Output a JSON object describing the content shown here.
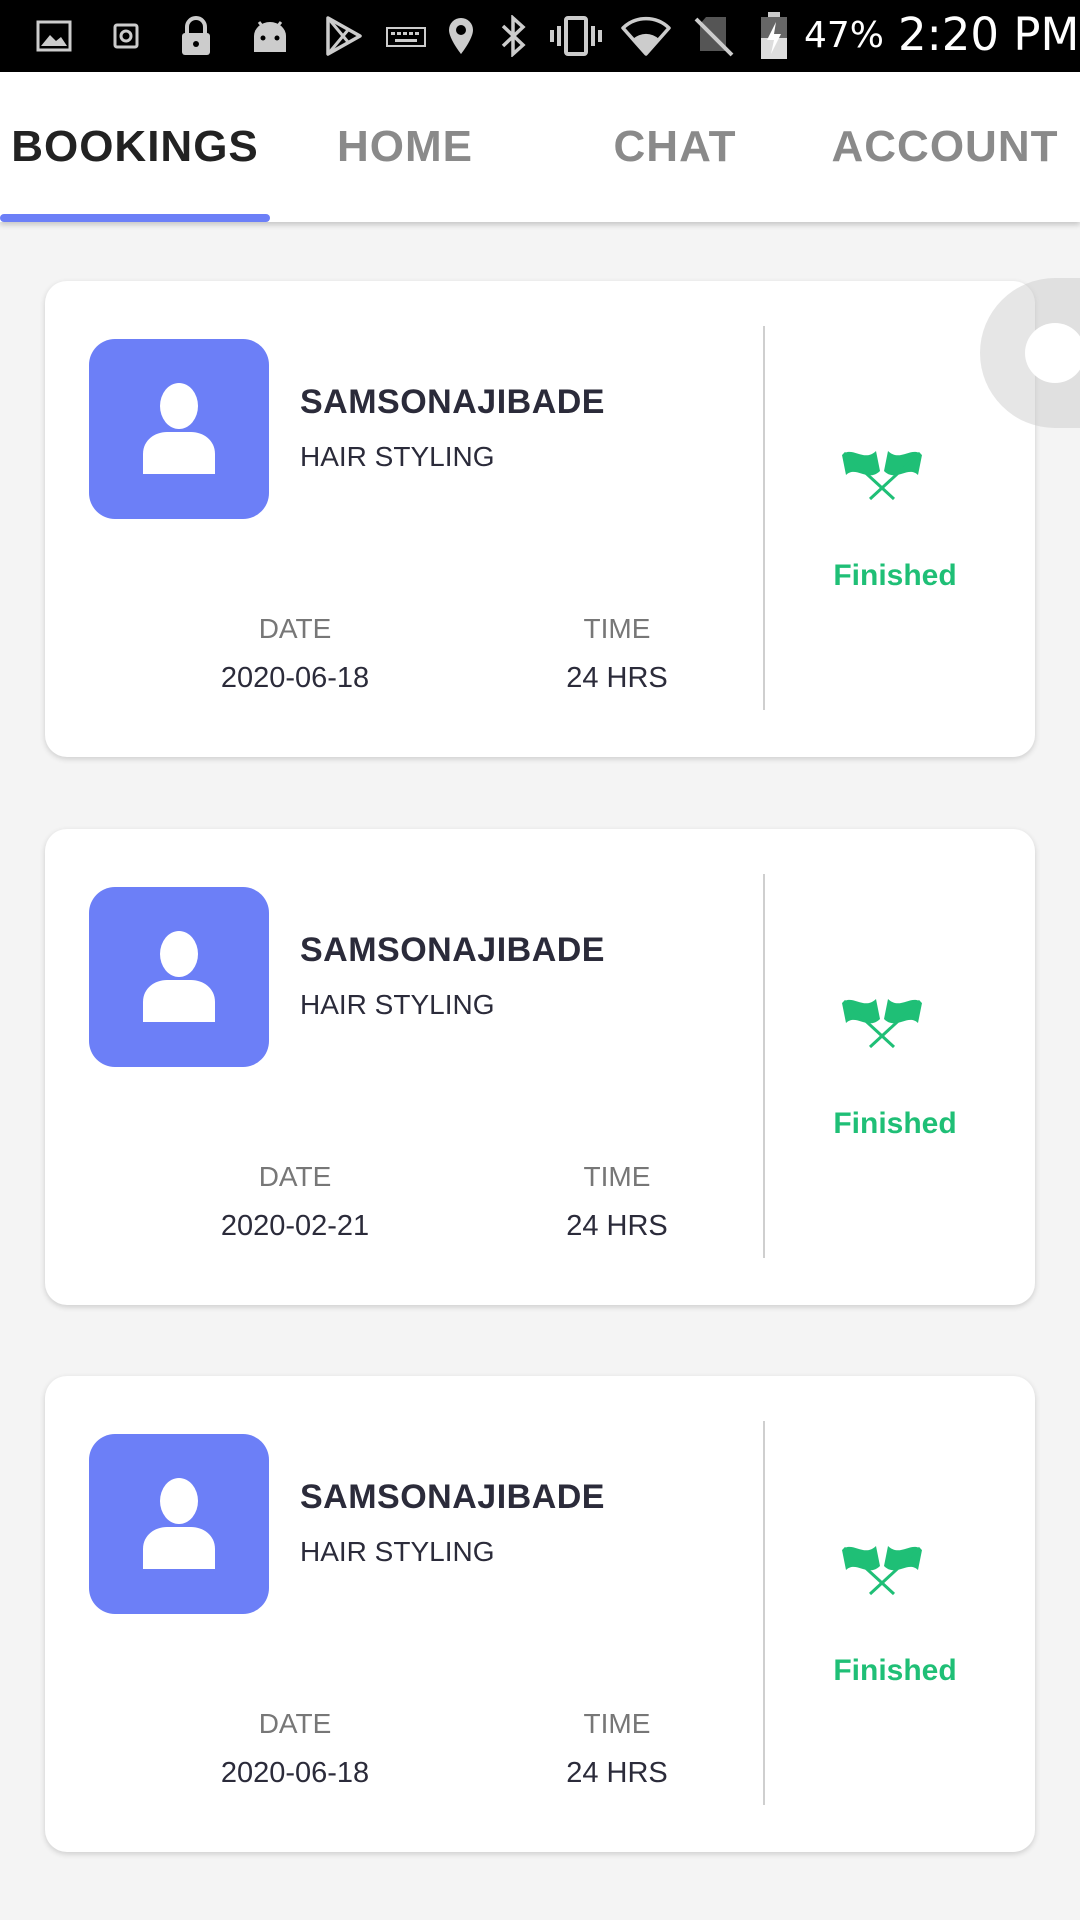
{
  "status_bar": {
    "battery_percent": "47%",
    "time": "2:20 PM",
    "icons": [
      "image-icon",
      "sim-icon",
      "lock-icon",
      "android-icon",
      "play-store-icon",
      "keyboard-icon",
      "location-icon",
      "bluetooth-icon",
      "vibrate-icon",
      "wifi-icon",
      "no-sim-icon",
      "battery-charging-icon"
    ]
  },
  "tabs": [
    {
      "label": "BOOKINGS",
      "active": true
    },
    {
      "label": "HOME",
      "active": false
    },
    {
      "label": "CHAT",
      "active": false
    },
    {
      "label": "ACCOUNT",
      "active": false
    }
  ],
  "labels": {
    "date": "DATE",
    "time": "TIME"
  },
  "bookings": [
    {
      "name": "SAMSONAJIBADE",
      "service": "HAIR STYLING",
      "date": "2020-06-18",
      "time": "24 HRS",
      "status": "Finished"
    },
    {
      "name": "SAMSONAJIBADE",
      "service": "HAIR STYLING",
      "date": "2020-02-21",
      "time": "24 HRS",
      "status": "Finished"
    },
    {
      "name": "SAMSONAJIBADE",
      "service": "HAIR STYLING",
      "date": "2020-06-18",
      "time": "24 HRS",
      "status": "Finished"
    }
  ],
  "colors": {
    "accent": "#6c7ff7",
    "finished": "#1fbf76",
    "background": "#f4f4f4"
  }
}
